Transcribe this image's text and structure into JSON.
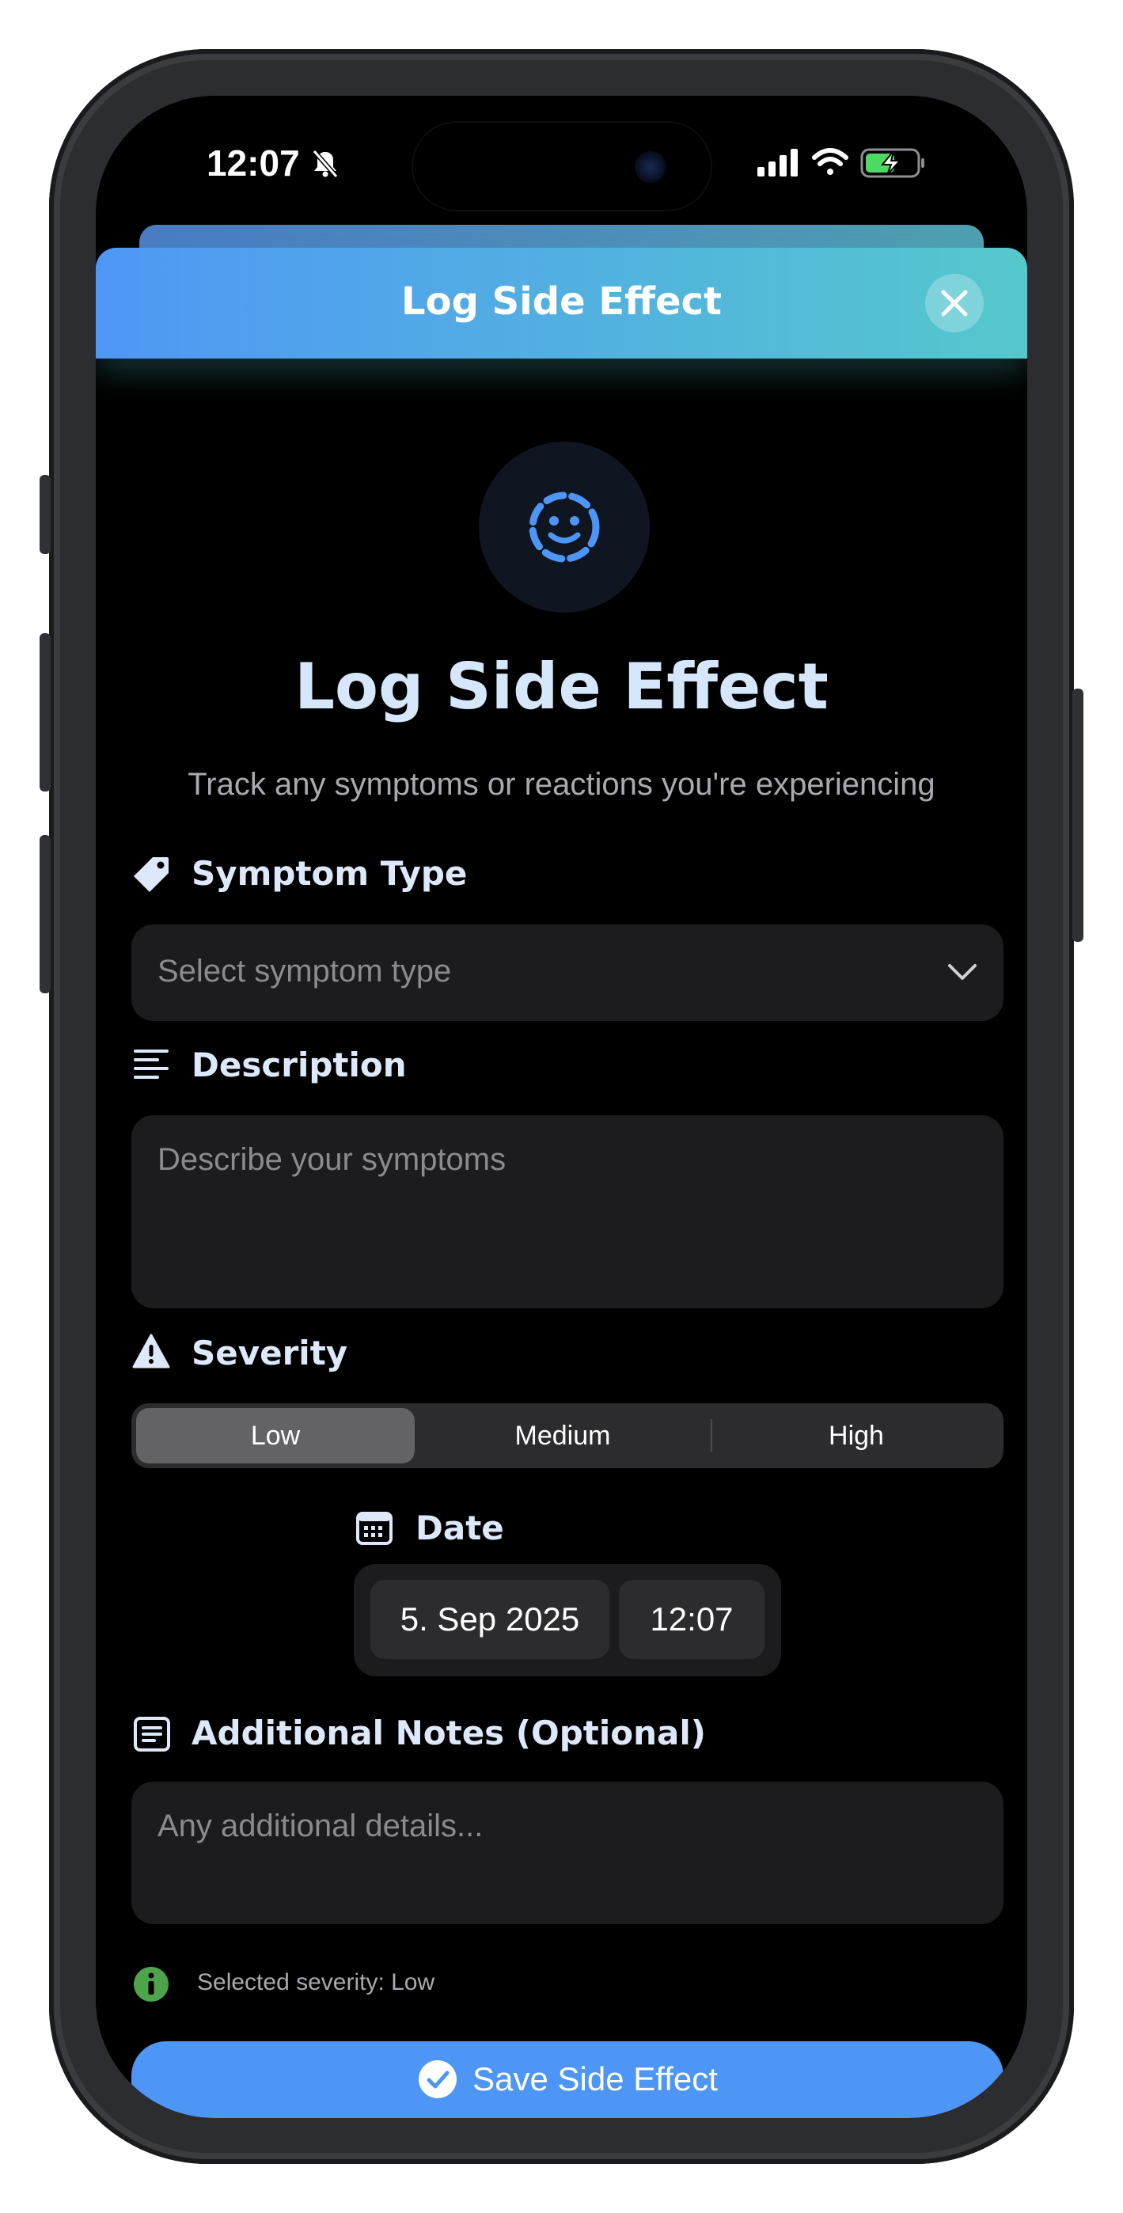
{
  "status_bar": {
    "time": "12:07"
  },
  "sheet": {
    "header_title": "Log Side Effect",
    "hero_title": "Log Side Effect",
    "subtitle": "Track any symptoms or reactions you're experiencing"
  },
  "symptom_type": {
    "label": "Symptom Type",
    "placeholder": "Select symptom type"
  },
  "description": {
    "label": "Description",
    "placeholder": "Describe your symptoms"
  },
  "severity": {
    "label": "Severity",
    "options": [
      "Low",
      "Medium",
      "High"
    ],
    "selected": "Low"
  },
  "date": {
    "label": "Date",
    "date_value": "5. Sep 2025",
    "time_value": "12:07"
  },
  "notes": {
    "label": "Additional Notes (Optional)",
    "placeholder": "Any additional details..."
  },
  "info": {
    "text": "Selected severity: Low"
  },
  "save": {
    "label": "Save Side Effect"
  },
  "colors": {
    "header_gradient_start": "#4f97f6",
    "header_gradient_end": "#55c8cc",
    "accent_blue": "#4e96f5",
    "label_text": "#dde9fa",
    "info_green": "#4ea44a"
  }
}
